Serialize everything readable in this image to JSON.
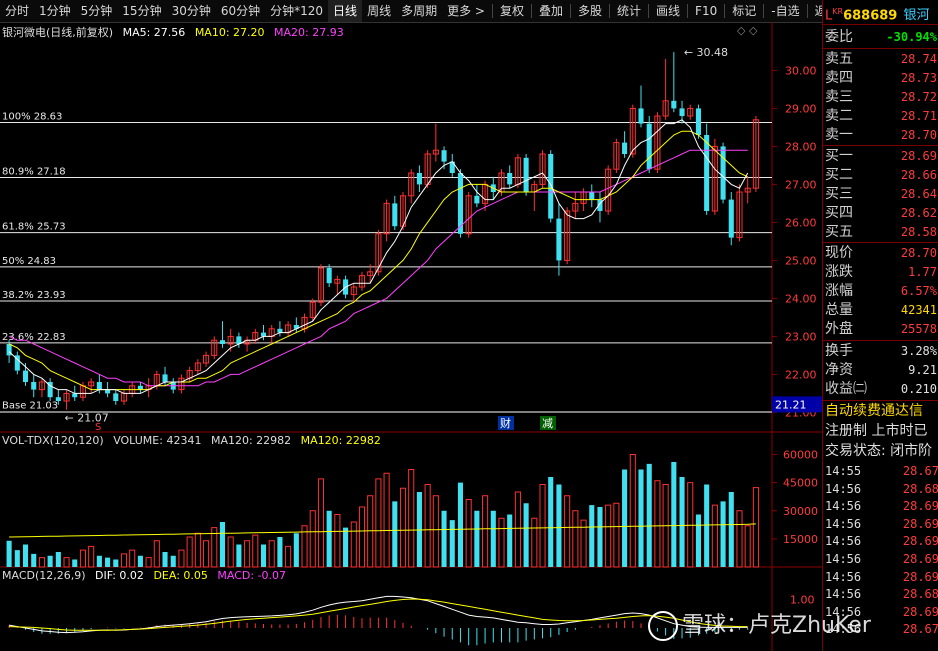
{
  "toolbar": {
    "left_items": [
      "分时",
      "1分钟",
      "5分钟",
      "15分钟",
      "30分钟",
      "60分钟",
      "分钟*120",
      "日线",
      "周线",
      "多周期",
      "更多 >"
    ],
    "active": "日线",
    "right_items": [
      "复权",
      "叠加",
      "多股",
      "统计",
      "画线",
      "F10",
      "标记",
      "-自选",
      "返回"
    ]
  },
  "header": {
    "stock": "银河微电(日线,前复权)",
    "ma5": "MA5: 27.56",
    "ma10": "MA10: 27.20",
    "ma20": "MA20: 27.93"
  },
  "price_axis": [
    "30.00",
    "29.00",
    "28.00",
    "27.00",
    "26.00",
    "25.00",
    "24.00",
    "23.00",
    "22.00",
    "21.00"
  ],
  "current_price_tag": "21.21",
  "fib_levels": [
    {
      "label": "100% 28.63",
      "value": 28.63
    },
    {
      "label": "80.9% 27.18",
      "value": 27.18
    },
    {
      "label": "61.8% 25.73",
      "value": 25.73
    },
    {
      "label": "50% 24.83",
      "value": 24.83
    },
    {
      "label": "38.2% 23.93",
      "value": 23.93
    },
    {
      "label": "23.6% 22.83",
      "value": 22.83
    },
    {
      "label": "Base 21.03",
      "value": 21.03
    }
  ],
  "annotations": {
    "high": "30.48",
    "low": "21.07",
    "fin": "财",
    "cut": "减",
    "s": "S"
  },
  "volume_panel": {
    "title": "VOL-TDX(120,120)",
    "volume": "VOLUME: 42341",
    "ma120": "MA120: 22982",
    "ma120b": "MA120: 22982",
    "axis": [
      "60000",
      "45000",
      "30000",
      "15000"
    ]
  },
  "macd_panel": {
    "title": "MACD(12,26,9)",
    "dif": "DIF: 0.02",
    "dea": "DEA: 0.05",
    "macd": "MACD: -0.07",
    "axis": [
      "1.00"
    ]
  },
  "quote": {
    "code_prefix": "L",
    "code_kr": "KR",
    "code": "688689",
    "name": "银河",
    "wei_label": "委比",
    "wei_value": "-30.94%",
    "sells": [
      {
        "label": "卖五",
        "price": "28.74"
      },
      {
        "label": "卖四",
        "price": "28.73"
      },
      {
        "label": "卖三",
        "price": "28.72"
      },
      {
        "label": "卖二",
        "price": "28.71"
      },
      {
        "label": "卖一",
        "price": "28.70"
      }
    ],
    "buys": [
      {
        "label": "买一",
        "price": "28.69"
      },
      {
        "label": "买二",
        "price": "28.66"
      },
      {
        "label": "买三",
        "price": "28.64"
      },
      {
        "label": "买四",
        "price": "28.62"
      },
      {
        "label": "买五",
        "price": "28.58"
      }
    ],
    "stats": [
      {
        "label": "现价",
        "value": "28.70",
        "color": "#ff3b3b"
      },
      {
        "label": "涨跌",
        "value": "1.77",
        "color": "#ff3b3b"
      },
      {
        "label": "涨幅",
        "value": "6.57%",
        "color": "#ff3b3b"
      },
      {
        "label": "总量",
        "value": "42341",
        "color": "#ffd800"
      },
      {
        "label": "外盘",
        "value": "25578",
        "color": "#ff3b3b"
      }
    ],
    "stats2": [
      {
        "label": "换手",
        "value": "3.28%",
        "color": "#e0e0e0"
      },
      {
        "label": "净资",
        "value": "9.21",
        "color": "#e0e0e0"
      },
      {
        "label": "收益㈡",
        "value": "0.210",
        "color": "#e0e0e0"
      }
    ],
    "ticker": "自动续费通达信",
    "reg": "注册制 上市时已",
    "status": "交易状态: 闭市阶",
    "ticks": [
      {
        "time": "14:55",
        "price": "28.67"
      },
      {
        "time": "14:56",
        "price": "28.68"
      },
      {
        "time": "14:56",
        "price": "28.69"
      },
      {
        "time": "14:56",
        "price": "28.69"
      },
      {
        "time": "14:56",
        "price": "28.69"
      },
      {
        "time": "14:56",
        "price": "28.69"
      },
      {
        "time": "14:56",
        "price": "28.69"
      },
      {
        "time": "14:56",
        "price": "28.68"
      },
      {
        "time": "14:56",
        "price": "28.69"
      },
      {
        "time": "14:56",
        "price": "28.67"
      }
    ]
  },
  "watermark": "雪球：卢克ZhuKer",
  "chart_data": {
    "type": "candlestick",
    "ylim": [
      20.8,
      30.8
    ],
    "ohlc": [
      [
        22.8,
        22.9,
        22.3,
        22.5
      ],
      [
        22.5,
        22.6,
        22.0,
        22.1
      ],
      [
        22.1,
        22.3,
        21.7,
        21.8
      ],
      [
        21.8,
        22.0,
        21.4,
        21.6
      ],
      [
        21.6,
        21.9,
        21.4,
        21.8
      ],
      [
        21.8,
        21.9,
        21.3,
        21.4
      ],
      [
        21.4,
        21.6,
        21.2,
        21.3
      ],
      [
        21.3,
        21.6,
        21.07,
        21.5
      ],
      [
        21.5,
        21.7,
        21.3,
        21.4
      ],
      [
        21.4,
        21.8,
        21.3,
        21.7
      ],
      [
        21.7,
        21.9,
        21.5,
        21.8
      ],
      [
        21.8,
        22.0,
        21.5,
        21.6
      ],
      [
        21.6,
        21.8,
        21.4,
        21.5
      ],
      [
        21.5,
        21.6,
        21.2,
        21.3
      ],
      [
        21.3,
        21.6,
        21.2,
        21.5
      ],
      [
        21.5,
        21.8,
        21.4,
        21.7
      ],
      [
        21.7,
        21.8,
        21.5,
        21.6
      ],
      [
        21.6,
        21.9,
        21.4,
        21.7
      ],
      [
        21.7,
        22.1,
        21.6,
        22.0
      ],
      [
        22.0,
        22.2,
        21.7,
        21.8
      ],
      [
        21.8,
        21.9,
        21.5,
        21.6
      ],
      [
        21.6,
        22.0,
        21.5,
        21.9
      ],
      [
        21.9,
        22.2,
        21.8,
        22.1
      ],
      [
        22.1,
        22.4,
        22.0,
        22.3
      ],
      [
        22.3,
        22.6,
        22.2,
        22.5
      ],
      [
        22.5,
        23.0,
        22.4,
        22.9
      ],
      [
        22.9,
        23.4,
        22.7,
        22.8
      ],
      [
        22.8,
        23.2,
        22.6,
        23.0
      ],
      [
        23.0,
        23.1,
        22.7,
        22.8
      ],
      [
        22.8,
        23.0,
        22.6,
        22.9
      ],
      [
        22.9,
        23.2,
        22.8,
        23.1
      ],
      [
        23.1,
        23.3,
        22.9,
        23.0
      ],
      [
        23.0,
        23.3,
        22.8,
        23.2
      ],
      [
        23.2,
        23.4,
        23.0,
        23.1
      ],
      [
        23.1,
        23.4,
        23.0,
        23.3
      ],
      [
        23.3,
        23.5,
        23.1,
        23.2
      ],
      [
        23.2,
        23.6,
        23.1,
        23.5
      ],
      [
        23.5,
        24.0,
        23.4,
        23.9
      ],
      [
        23.9,
        24.9,
        23.8,
        24.8
      ],
      [
        24.8,
        24.9,
        24.3,
        24.4
      ],
      [
        24.4,
        24.6,
        24.1,
        24.5
      ],
      [
        24.5,
        24.6,
        24.0,
        24.1
      ],
      [
        24.1,
        24.4,
        23.9,
        24.3
      ],
      [
        24.3,
        24.7,
        24.2,
        24.6
      ],
      [
        24.6,
        24.9,
        24.4,
        24.7
      ],
      [
        24.7,
        25.8,
        24.6,
        25.7
      ],
      [
        25.7,
        26.6,
        25.5,
        26.5
      ],
      [
        26.5,
        26.7,
        25.8,
        25.9
      ],
      [
        25.9,
        26.8,
        25.8,
        26.7
      ],
      [
        26.7,
        27.4,
        26.5,
        27.3
      ],
      [
        27.3,
        27.5,
        26.8,
        27.0
      ],
      [
        27.0,
        27.9,
        26.9,
        27.8
      ],
      [
        27.8,
        28.6,
        27.6,
        27.9
      ],
      [
        27.9,
        28.0,
        27.4,
        27.6
      ],
      [
        27.6,
        27.8,
        27.2,
        27.3
      ],
      [
        27.3,
        27.4,
        25.6,
        25.7
      ],
      [
        25.7,
        26.8,
        25.6,
        26.7
      ],
      [
        26.7,
        27.0,
        26.4,
        26.5
      ],
      [
        26.5,
        27.1,
        26.3,
        27.0
      ],
      [
        27.0,
        27.2,
        26.6,
        26.8
      ],
      [
        26.8,
        27.4,
        26.7,
        27.3
      ],
      [
        27.3,
        27.5,
        26.9,
        27.0
      ],
      [
        27.0,
        27.8,
        26.9,
        27.7
      ],
      [
        27.7,
        27.8,
        26.7,
        26.8
      ],
      [
        26.8,
        27.1,
        26.3,
        27.0
      ],
      [
        27.0,
        27.9,
        26.9,
        27.8
      ],
      [
        27.8,
        27.9,
        26.0,
        26.1
      ],
      [
        26.1,
        26.5,
        24.6,
        25.0
      ],
      [
        25.0,
        26.4,
        24.9,
        26.3
      ],
      [
        26.3,
        26.8,
        26.1,
        26.5
      ],
      [
        26.5,
        26.9,
        26.3,
        26.8
      ],
      [
        26.8,
        27.0,
        26.4,
        26.6
      ],
      [
        26.6,
        26.8,
        26.0,
        26.3
      ],
      [
        26.3,
        27.5,
        26.2,
        27.4
      ],
      [
        27.4,
        28.2,
        27.3,
        28.1
      ],
      [
        28.1,
        28.4,
        27.7,
        27.8
      ],
      [
        27.8,
        29.1,
        27.7,
        29.0
      ],
      [
        29.0,
        29.6,
        28.5,
        28.6
      ],
      [
        28.6,
        28.8,
        27.3,
        27.4
      ],
      [
        27.4,
        28.9,
        27.3,
        28.8
      ],
      [
        28.8,
        30.3,
        28.7,
        29.2
      ],
      [
        29.2,
        30.48,
        28.9,
        29.0
      ],
      [
        29.0,
        29.2,
        28.6,
        28.8
      ],
      [
        28.8,
        29.1,
        28.7,
        29.0
      ],
      [
        29.0,
        29.1,
        28.2,
        28.3
      ],
      [
        28.3,
        28.6,
        26.2,
        26.3
      ],
      [
        26.3,
        28.2,
        26.2,
        28.0
      ],
      [
        28.0,
        28.1,
        26.5,
        26.6
      ],
      [
        26.6,
        26.8,
        25.4,
        25.6
      ],
      [
        25.6,
        27.0,
        25.5,
        26.8
      ],
      [
        26.8,
        27.2,
        26.5,
        26.9
      ],
      [
        26.9,
        28.8,
        26.8,
        28.7
      ]
    ],
    "ma5": [
      22.6,
      22.4,
      22.2,
      22.0,
      21.9,
      21.7,
      21.6,
      21.6,
      21.5,
      21.5,
      21.5,
      21.6,
      21.6,
      21.6,
      21.5,
      21.5,
      21.5,
      21.6,
      21.7,
      21.8,
      21.8,
      21.8,
      21.9,
      22.0,
      22.1,
      22.3,
      22.5,
      22.7,
      22.8,
      22.9,
      22.9,
      23.0,
      23.0,
      23.1,
      23.1,
      23.2,
      23.3,
      23.4,
      23.7,
      23.9,
      24.1,
      24.3,
      24.4,
      24.4,
      24.4,
      24.8,
      25.2,
      25.5,
      25.9,
      26.4,
      26.7,
      27.0,
      27.3,
      27.5,
      27.6,
      27.3,
      27.1,
      26.8,
      26.6,
      26.6,
      26.9,
      26.9,
      27.0,
      27.1,
      27.2,
      27.3,
      27.0,
      26.5,
      26.2,
      26.1,
      26.1,
      26.2,
      26.5,
      26.7,
      27.0,
      27.5,
      27.9,
      28.1,
      28.2,
      28.4,
      28.6,
      28.6,
      28.7,
      28.5,
      28.0,
      27.7,
      27.4,
      27.2,
      27.0,
      26.9,
      27.3
    ],
    "ma10": [
      22.8,
      22.7,
      22.5,
      22.4,
      22.3,
      22.1,
      22.0,
      21.9,
      21.8,
      21.7,
      21.6,
      21.6,
      21.6,
      21.6,
      21.6,
      21.6,
      21.6,
      21.6,
      21.7,
      21.7,
      21.8,
      21.8,
      21.8,
      21.9,
      21.9,
      22.0,
      22.1,
      22.3,
      22.4,
      22.5,
      22.6,
      22.7,
      22.8,
      22.9,
      23.0,
      23.1,
      23.2,
      23.3,
      23.4,
      23.5,
      23.6,
      23.8,
      23.9,
      24.1,
      24.2,
      24.4,
      24.6,
      24.8,
      25.0,
      25.3,
      25.7,
      26.0,
      26.3,
      26.6,
      26.8,
      26.9,
      27.0,
      27.0,
      27.0,
      26.9,
      26.8,
      26.8,
      26.8,
      26.8,
      26.8,
      26.9,
      26.9,
      26.8,
      26.7,
      26.6,
      26.6,
      26.6,
      26.6,
      26.7,
      26.8,
      27.0,
      27.2,
      27.5,
      27.7,
      27.9,
      28.1,
      28.3,
      28.4,
      28.4,
      28.3,
      28.1,
      27.9,
      27.7,
      27.5,
      27.3,
      27.2
    ],
    "ma20": [
      23.0,
      22.9,
      22.9,
      22.8,
      22.7,
      22.6,
      22.5,
      22.4,
      22.3,
      22.2,
      22.1,
      22.0,
      21.9,
      21.9,
      21.8,
      21.8,
      21.8,
      21.7,
      21.7,
      21.7,
      21.7,
      21.7,
      21.7,
      21.7,
      21.8,
      21.8,
      21.9,
      22.0,
      22.0,
      22.1,
      22.2,
      22.3,
      22.4,
      22.5,
      22.6,
      22.7,
      22.8,
      22.9,
      23.0,
      23.2,
      23.3,
      23.4,
      23.6,
      23.7,
      23.8,
      23.9,
      24.0,
      24.2,
      24.4,
      24.6,
      24.8,
      25.0,
      25.3,
      25.5,
      25.7,
      25.9,
      26.1,
      26.3,
      26.4,
      26.5,
      26.6,
      26.7,
      26.8,
      26.8,
      26.8,
      26.8,
      26.8,
      26.8,
      26.8,
      26.8,
      26.8,
      26.8,
      26.8,
      26.9,
      27.0,
      27.1,
      27.2,
      27.3,
      27.4,
      27.5,
      27.6,
      27.7,
      27.8,
      27.9,
      27.9,
      27.9,
      27.9,
      27.9,
      27.9,
      27.9,
      27.9
    ],
    "volume": [
      14000,
      9000,
      12000,
      7000,
      5000,
      6000,
      8000,
      5000,
      4000,
      9000,
      11000,
      6000,
      5000,
      4000,
      7000,
      9000,
      6000,
      5000,
      14000,
      8000,
      6000,
      9000,
      16000,
      18000,
      14000,
      21000,
      24000,
      16000,
      12000,
      14000,
      17000,
      12000,
      14000,
      16000,
      11000,
      18000,
      22000,
      30000,
      47000,
      30000,
      28000,
      21000,
      24000,
      32000,
      38000,
      47000,
      50000,
      35000,
      42000,
      52000,
      40000,
      44000,
      38000,
      30000,
      25000,
      45000,
      36000,
      30000,
      38000,
      30000,
      26000,
      28000,
      40000,
      34000,
      26000,
      44000,
      48000,
      44000,
      38000,
      30000,
      25000,
      33000,
      32000,
      33000,
      34000,
      52000,
      60000,
      52000,
      55000,
      46000,
      44000,
      56000,
      48000,
      45000,
      28000,
      44000,
      33000,
      35000,
      40000,
      30000,
      22000,
      42341
    ],
    "volume_ma120": 22982,
    "vol_ylim": [
      0,
      64000
    ],
    "dif": [
      0.1,
      0.05,
      0.0,
      -0.05,
      -0.1,
      -0.12,
      -0.15,
      -0.16,
      -0.15,
      -0.13,
      -0.1,
      -0.08,
      -0.07,
      -0.08,
      -0.07,
      -0.05,
      -0.03,
      0.0,
      0.05,
      0.08,
      0.1,
      0.12,
      0.15,
      0.18,
      0.22,
      0.28,
      0.33,
      0.36,
      0.38,
      0.39,
      0.4,
      0.41,
      0.42,
      0.44,
      0.46,
      0.49,
      0.55,
      0.62,
      0.72,
      0.8,
      0.86,
      0.9,
      0.92,
      0.95,
      1.0,
      1.05,
      1.1,
      1.1,
      1.08,
      1.05,
      1.0,
      0.95,
      0.85,
      0.75,
      0.65,
      0.55,
      0.45,
      0.4,
      0.38,
      0.35,
      0.3,
      0.25,
      0.2,
      0.18,
      0.15,
      0.12,
      0.12,
      0.14,
      0.18,
      0.22,
      0.26,
      0.3,
      0.35,
      0.4,
      0.45,
      0.5,
      0.52,
      0.5,
      0.45,
      0.35,
      0.25,
      0.15,
      0.1,
      0.05,
      0.03,
      0.02,
      0.02,
      0.02,
      0.02,
      0.02,
      0.02
    ],
    "dea": [
      0.05,
      0.04,
      0.03,
      0.02,
      0.0,
      -0.02,
      -0.05,
      -0.07,
      -0.08,
      -0.08,
      -0.08,
      -0.08,
      -0.08,
      -0.07,
      -0.06,
      -0.05,
      -0.04,
      -0.02,
      0.0,
      0.02,
      0.04,
      0.06,
      0.08,
      0.1,
      0.13,
      0.16,
      0.2,
      0.24,
      0.27,
      0.3,
      0.32,
      0.34,
      0.36,
      0.38,
      0.4,
      0.42,
      0.45,
      0.48,
      0.53,
      0.58,
      0.63,
      0.68,
      0.73,
      0.78,
      0.82,
      0.87,
      0.92,
      0.96,
      0.99,
      1.01,
      1.0,
      0.98,
      0.94,
      0.9,
      0.85,
      0.8,
      0.75,
      0.7,
      0.65,
      0.6,
      0.55,
      0.5,
      0.45,
      0.4,
      0.35,
      0.3,
      0.28,
      0.26,
      0.25,
      0.25,
      0.26,
      0.28,
      0.3,
      0.32,
      0.34,
      0.37,
      0.4,
      0.42,
      0.43,
      0.41,
      0.38,
      0.34,
      0.28,
      0.22,
      0.16,
      0.12,
      0.09,
      0.07,
      0.06,
      0.05,
      0.05
    ],
    "macd_ylim": [
      -0.8,
      1.6
    ]
  }
}
